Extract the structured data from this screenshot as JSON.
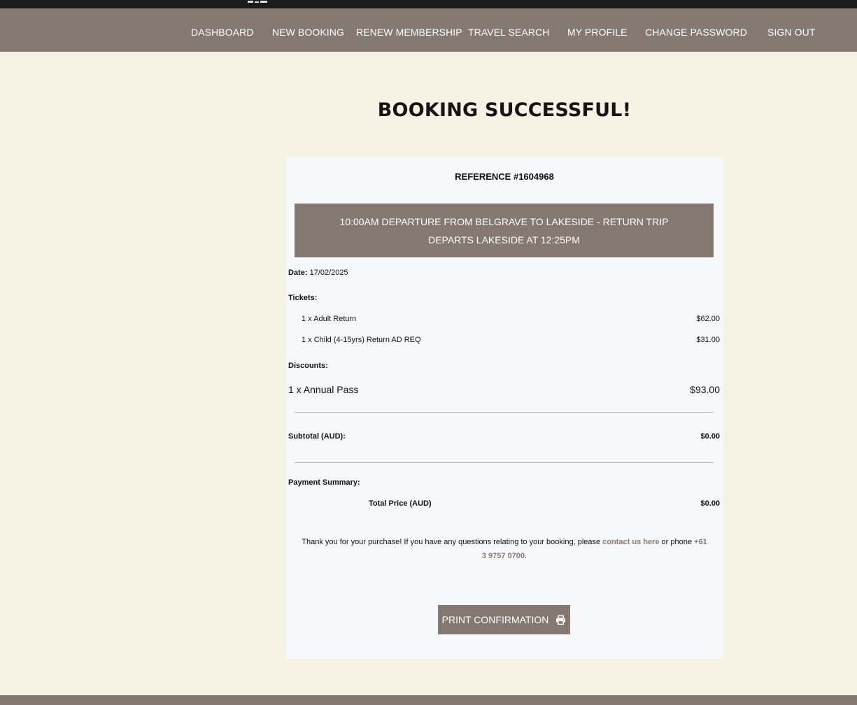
{
  "nav": {
    "items": [
      {
        "label": "DASHBOARD"
      },
      {
        "label": "NEW BOOKING"
      },
      {
        "label": "RENEW MEMBERSHIP"
      },
      {
        "label": "TRAVEL SEARCH"
      },
      {
        "label": "MY PROFILE"
      },
      {
        "label": "CHANGE PASSWORD"
      },
      {
        "label": "SIGN OUT"
      }
    ]
  },
  "page": {
    "title": "BOOKING SUCCESSFUL!"
  },
  "booking": {
    "reference": "REFERENCE #1604968",
    "trip": "10:00AM DEPARTURE FROM BELGRAVE TO LAKESIDE - RETURN TRIP DEPARTS LAKESIDE AT 12:25PM",
    "date_label": "Date:",
    "date_value": "17/02/2025",
    "tickets_label": "Tickets:",
    "tickets": [
      {
        "name": "1 x Adult Return",
        "price": "$62.00"
      },
      {
        "name": "1 x Child (4-15yrs) Return AD REQ",
        "price": "$31.00"
      }
    ],
    "discounts_label": "Discounts:",
    "discounts": [
      {
        "name": "1 x Annual Pass",
        "price": "$93.00"
      }
    ],
    "subtotal_label": "Subtotal (AUD):",
    "subtotal_value": "$0.00",
    "payment_summary_label": "Payment Summary:",
    "total_label": "Total Price (AUD)",
    "total_value": "$0.00"
  },
  "thanks": {
    "text_before": "Thank you for your purchase! If you have any questions relating to your booking, please ",
    "contact_link": "contact us here",
    "text_middle": " or phone ",
    "phone_link": "+61 3 9757 0700",
    "text_after": "."
  },
  "actions": {
    "print_label": "PRINT CONFIRMATION"
  },
  "colors": {
    "brand": "#847970",
    "page_bg": "#f7f3e4",
    "card_bg": "#f7f8fb"
  }
}
